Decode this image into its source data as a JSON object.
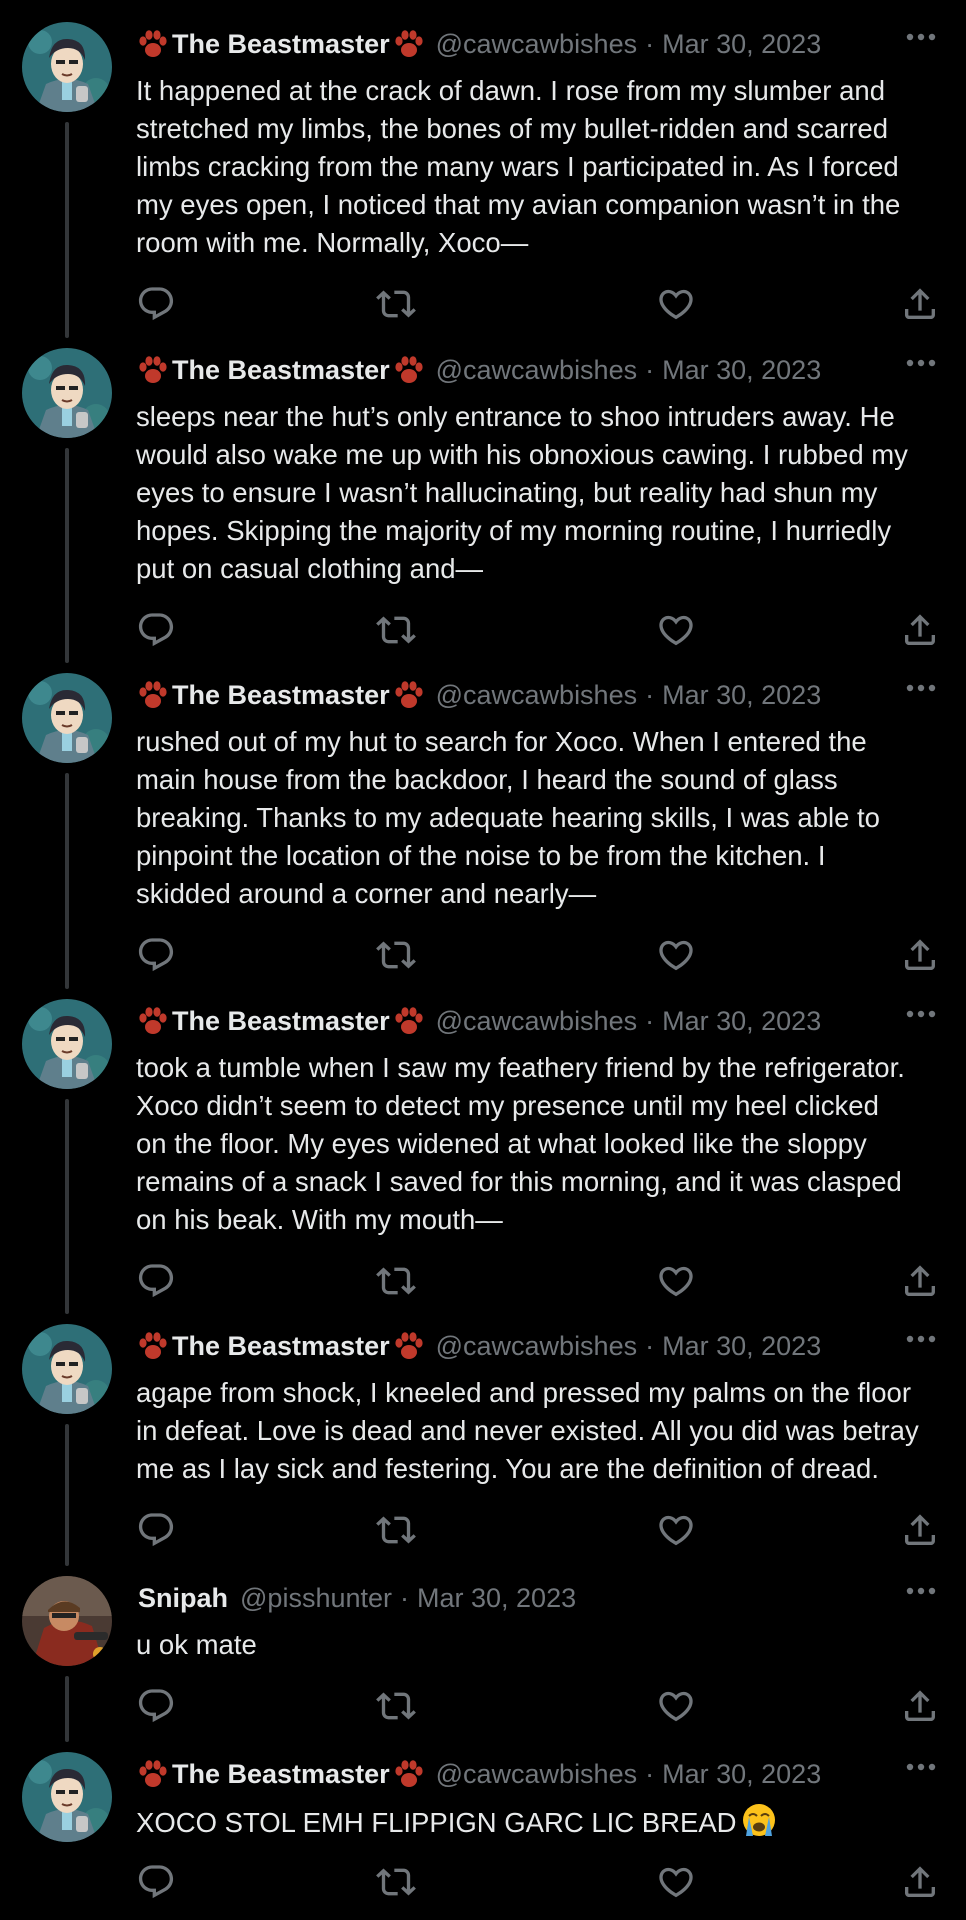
{
  "tweets": [
    {
      "author": "beastmaster",
      "name": "The Beastmaster",
      "handle": "@cawcawbishes",
      "separator": "·",
      "date": "Mar 30, 2023",
      "lines": [
        "It happened at the crack of dawn. I rose from my slumber and",
        "stretched my limbs, the bones of my bullet-ridden and scarred",
        "limbs cracking from the many wars I participated in. As I forced",
        "my eyes open, I noticed that my avian companion wasn’t in the",
        "room with me. Normally, Xoco—"
      ]
    },
    {
      "author": "beastmaster",
      "name": "The Beastmaster",
      "handle": "@cawcawbishes",
      "separator": "·",
      "date": "Mar 30, 2023",
      "lines": [
        "sleeps near the hut’s only entrance to shoo intruders away. He",
        "would also wake me up with his obnoxious cawing. I rubbed my",
        "eyes to ensure I wasn’t hallucinating, but reality had shun my",
        "hopes. Skipping the majority of my morning routine, I hurriedly",
        "put on casual clothing and—"
      ]
    },
    {
      "author": "beastmaster",
      "name": "The Beastmaster",
      "handle": "@cawcawbishes",
      "separator": "·",
      "date": "Mar 30, 2023",
      "lines": [
        "rushed out of my hut to search for Xoco. When I entered the",
        "main house from the backdoor, I heard the sound of glass",
        "breaking. Thanks to my adequate hearing skills, I was able to",
        "pinpoint the location of the noise to be from the kitchen. I",
        "skidded around a corner and nearly—"
      ]
    },
    {
      "author": "beastmaster",
      "name": "The Beastmaster",
      "handle": "@cawcawbishes",
      "separator": "·",
      "date": "Mar 30, 2023",
      "lines": [
        "took a tumble when I saw my feathery friend by the refrigerator.",
        "Xoco didn’t seem to detect my presence until my heel clicked",
        "on the floor. My eyes widened at what looked like the sloppy",
        "remains of a snack I saved for this morning, and it was clasped",
        "on his beak. With my mouth—"
      ]
    },
    {
      "author": "beastmaster",
      "name": "The Beastmaster",
      "handle": "@cawcawbishes",
      "separator": "·",
      "date": "Mar 30, 2023",
      "lines": [
        "agape from shock, I kneeled and pressed my palms on the floor",
        "in defeat. Love is dead and never existed. All you did was betray",
        "me as I lay sick and festering. You are the definition of dread."
      ]
    },
    {
      "author": "snipah",
      "name": "Snipah",
      "handle": "@pisshunter",
      "separator": "·",
      "date": "Mar 30, 2023",
      "lines": [
        "u ok mate"
      ]
    },
    {
      "author": "beastmaster",
      "name": "The Beastmaster",
      "handle": "@cawcawbishes",
      "separator": "·",
      "date": "Mar 30, 2023",
      "lines": [
        "XOCO STOL EMH FLIPPIGN GARC LIC BREAD"
      ],
      "trailing_emoji": "loudly-crying-face-emoji"
    }
  ],
  "icons": {
    "reply": "reply-icon",
    "retweet": "retweet-icon",
    "like": "like-icon",
    "share": "share-icon",
    "more": "more-icon",
    "paw": "paw-print-icon"
  },
  "colors": {
    "background": "#000000",
    "primary_text": "#e7e9ea",
    "secondary_text": "#71767b",
    "thread_line": "#333639",
    "paw": "#c0392b"
  }
}
